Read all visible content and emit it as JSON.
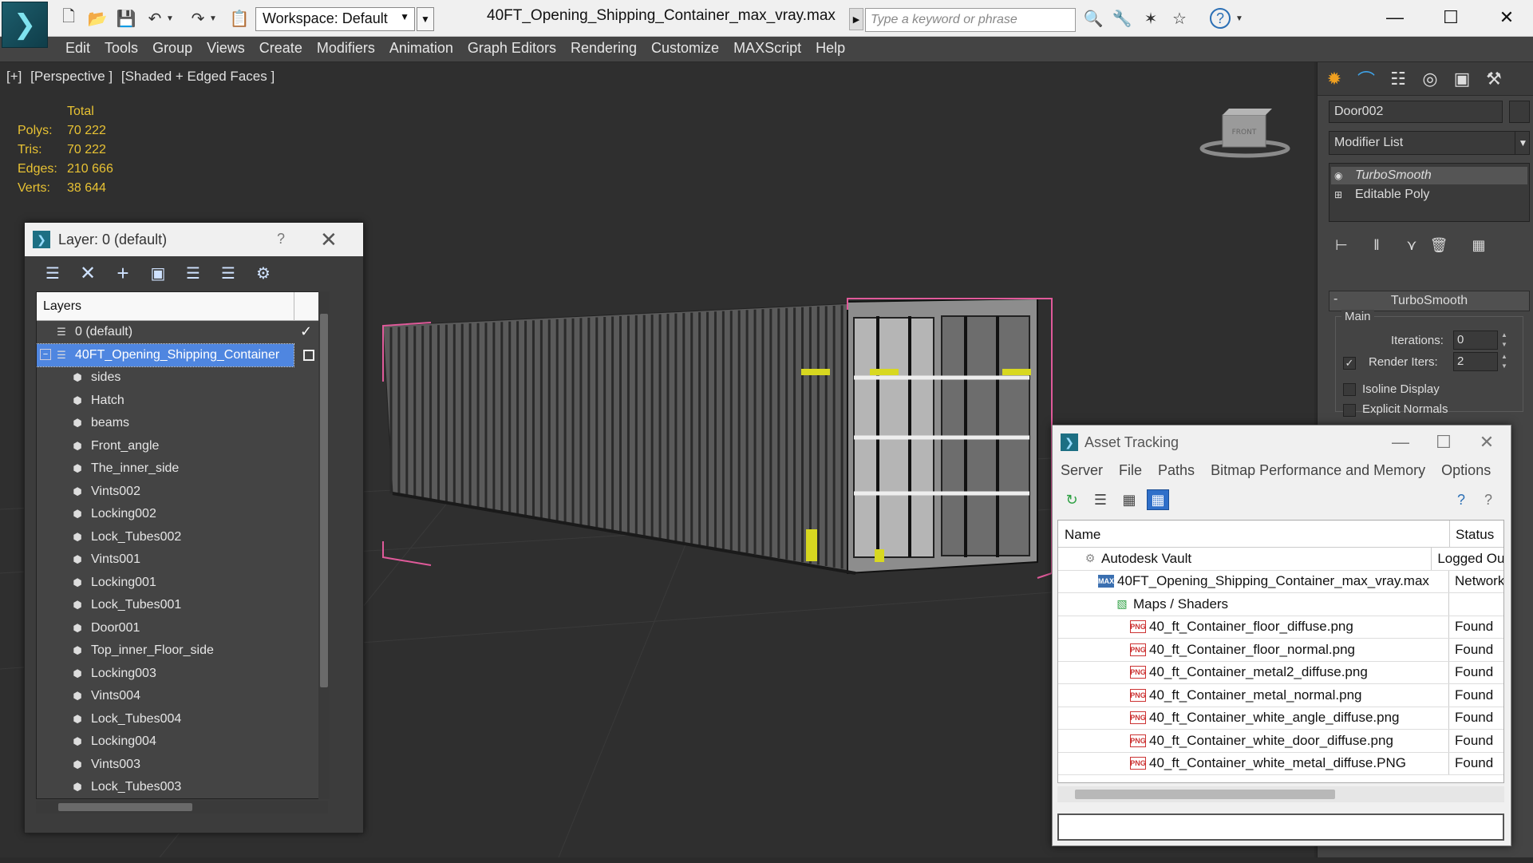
{
  "titlebar": {
    "workspace": "Workspace: Default",
    "file_title": "40FT_Opening_Shipping_Container_max_vray.max",
    "search_placeholder": "Type a keyword or phrase"
  },
  "menu": [
    "Edit",
    "Tools",
    "Group",
    "Views",
    "Create",
    "Modifiers",
    "Animation",
    "Graph Editors",
    "Rendering",
    "Customize",
    "MAXScript",
    "Help"
  ],
  "viewport": {
    "label": [
      "[+]",
      "[Perspective ]",
      "[Shaded + Edged Faces ]"
    ],
    "stats": {
      "header": "Total",
      "rows": [
        {
          "k": "Polys:",
          "v": "70 222"
        },
        {
          "k": "Tris:",
          "v": "70 222"
        },
        {
          "k": "Edges:",
          "v": "210 666"
        },
        {
          "k": "Verts:",
          "v": "38 644"
        }
      ]
    },
    "viewcube_label": "FRONT"
  },
  "layer_dialog": {
    "title": "Layer: 0 (default)",
    "help": "?",
    "column": "Layers",
    "rows": [
      {
        "label": "0 (default)",
        "kind": "layer",
        "indent": 1,
        "check": "✓"
      },
      {
        "label": "40FT_Opening_Shipping_Container",
        "kind": "layer",
        "indent": 1,
        "selected": true,
        "expander": "−"
      },
      {
        "label": "sides",
        "kind": "object",
        "indent": 2
      },
      {
        "label": "Hatch",
        "kind": "object",
        "indent": 2
      },
      {
        "label": "beams",
        "kind": "object",
        "indent": 2
      },
      {
        "label": "Front_angle",
        "kind": "object",
        "indent": 2
      },
      {
        "label": "The_inner_side",
        "kind": "object",
        "indent": 2
      },
      {
        "label": "Vints002",
        "kind": "object",
        "indent": 2
      },
      {
        "label": "Locking002",
        "kind": "object",
        "indent": 2
      },
      {
        "label": "Lock_Tubes002",
        "kind": "object",
        "indent": 2
      },
      {
        "label": "Vints001",
        "kind": "object",
        "indent": 2
      },
      {
        "label": "Locking001",
        "kind": "object",
        "indent": 2
      },
      {
        "label": "Lock_Tubes001",
        "kind": "object",
        "indent": 2
      },
      {
        "label": "Door001",
        "kind": "object",
        "indent": 2
      },
      {
        "label": "Top_inner_Floor_side",
        "kind": "object",
        "indent": 2
      },
      {
        "label": "Locking003",
        "kind": "object",
        "indent": 2
      },
      {
        "label": "Vints004",
        "kind": "object",
        "indent": 2
      },
      {
        "label": "Lock_Tubes004",
        "kind": "object",
        "indent": 2
      },
      {
        "label": "Locking004",
        "kind": "object",
        "indent": 2
      },
      {
        "label": "Vints003",
        "kind": "object",
        "indent": 2
      },
      {
        "label": "Lock_Tubes003",
        "kind": "object",
        "indent": 2
      }
    ]
  },
  "command_panel": {
    "object_name": "Door002",
    "modifier_list": "Modifier List",
    "stack": [
      "TurboSmooth",
      "Editable Poly"
    ],
    "rollout_title": "TurboSmooth",
    "rollout_minus": "-",
    "group_main": "Main",
    "iterations_label": "Iterations:",
    "iterations_value": "0",
    "render_iters_label": "Render Iters:",
    "render_iters_value": "2",
    "render_iters_checked": "✓",
    "isoline_label": "Isoline Display",
    "explicit_label": "Explicit Normals"
  },
  "asset_dialog": {
    "title": "Asset Tracking",
    "menu": [
      "Server",
      "File",
      "Paths",
      "Bitmap Performance and Memory",
      "Options"
    ],
    "col_name": "Name",
    "col_status": "Status",
    "png_tag": "PNG",
    "max_tag": "MAX",
    "rows": [
      {
        "name": "Autodesk Vault",
        "status": "Logged Out",
        "icon": "vault",
        "indent": 1
      },
      {
        "name": "40FT_Opening_Shipping_Container_max_vray.max",
        "status": "Network",
        "icon": "max",
        "indent": 2
      },
      {
        "name": "Maps / Shaders",
        "status": "",
        "icon": "maps",
        "indent": 3
      },
      {
        "name": "40_ft_Container_floor_diffuse.png",
        "status": "Found",
        "icon": "png",
        "indent": 4
      },
      {
        "name": "40_ft_Container_floor_normal.png",
        "status": "Found",
        "icon": "png",
        "indent": 4
      },
      {
        "name": "40_ft_Container_metal2_diffuse.png",
        "status": "Found",
        "icon": "png",
        "indent": 4
      },
      {
        "name": "40_ft_Container_metal_normal.png",
        "status": "Found",
        "icon": "png",
        "indent": 4
      },
      {
        "name": "40_ft_Container_white_angle_diffuse.png",
        "status": "Found",
        "icon": "png",
        "indent": 4
      },
      {
        "name": "40_ft_Container_white_door_diffuse.png",
        "status": "Found",
        "icon": "png",
        "indent": 4
      },
      {
        "name": "40_ft_Container_white_metal_diffuse.PNG",
        "status": "Found",
        "icon": "png",
        "indent": 4
      }
    ]
  }
}
